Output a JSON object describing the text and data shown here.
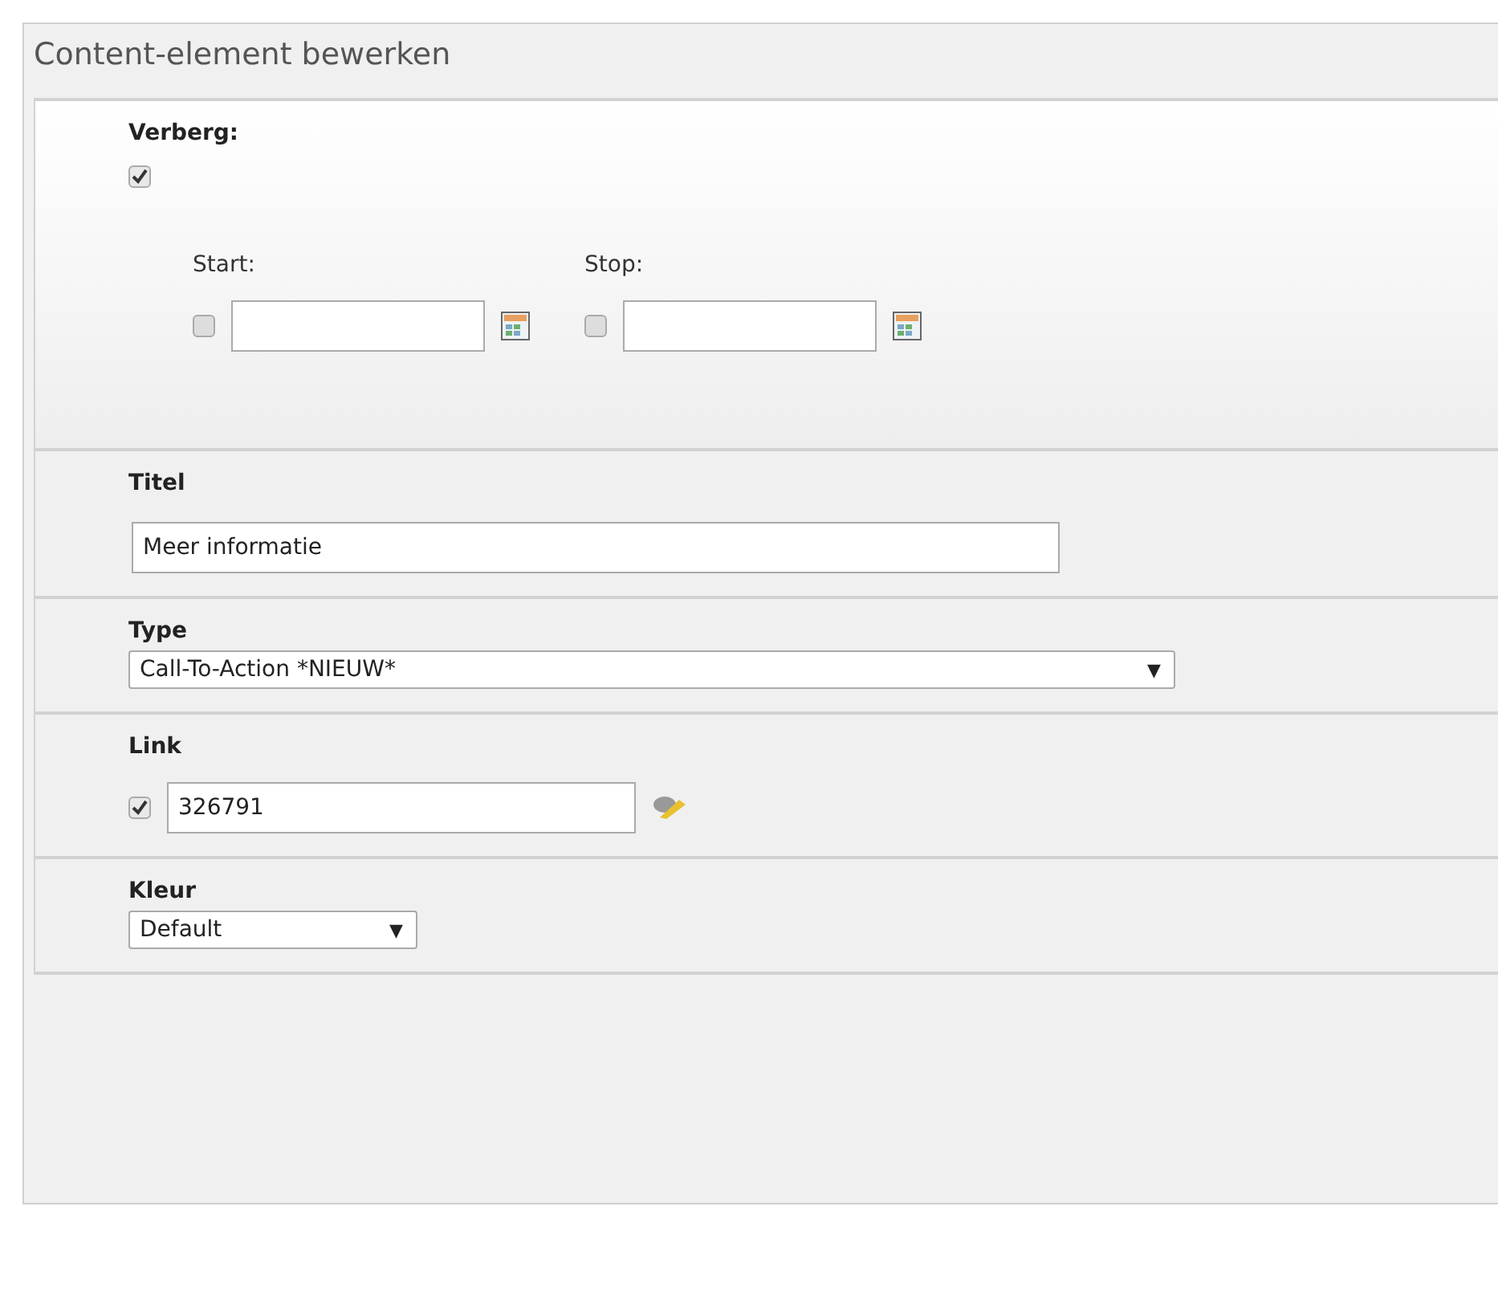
{
  "panel": {
    "title": "Content-element bewerken"
  },
  "hide": {
    "label": "Verberg:",
    "checked": true,
    "start": {
      "label": "Start:",
      "checked": false
    },
    "stop": {
      "label": "Stop:",
      "checked": false
    }
  },
  "fields": [
    {
      "kind": "text",
      "label": "Titel",
      "value": "Meer informatie"
    },
    {
      "kind": "select",
      "label": "Type",
      "value": "Call-To-Action *NIEUW*",
      "arrow": "▼"
    },
    {
      "kind": "link",
      "label": "Link",
      "checked": true,
      "value": "326791"
    },
    {
      "kind": "select",
      "label": "Kleur",
      "value": "Default",
      "arrow": "▼"
    }
  ]
}
